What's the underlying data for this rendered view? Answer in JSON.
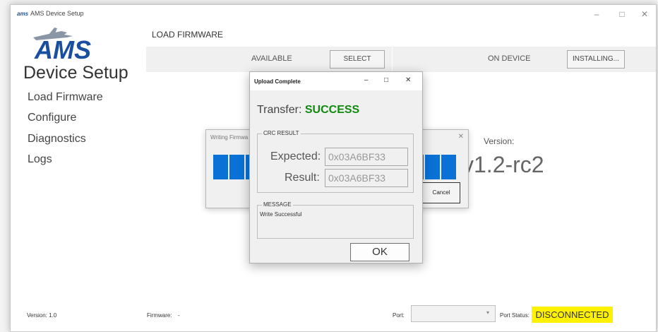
{
  "window": {
    "app_icon_text": "ams",
    "title": "AMS Device Setup",
    "minimize": "–",
    "maximize": "□",
    "close": "✕"
  },
  "brand": {
    "logo_text": "AMS",
    "subtitle": "Device Setup"
  },
  "nav": [
    {
      "label": "Load Firmware"
    },
    {
      "label": "Configure"
    },
    {
      "label": "Diagnostics"
    },
    {
      "label": "Logs"
    }
  ],
  "main": {
    "section_title": "LOAD FIRMWARE",
    "available_label": "AVAILABLE",
    "select_label": "SELECT",
    "on_device_label": "ON DEVICE",
    "installing_label": "INSTALLING...",
    "version_label": "Version:",
    "version_value": "v1.2-rc2"
  },
  "writing_dialog": {
    "title": "Writing Firmwa",
    "close": "✕",
    "cancel_label": "Cancel"
  },
  "upload_dialog": {
    "title": "Upload Complete",
    "minimize": "–",
    "maximize": "□",
    "close": "✕",
    "transfer_label": "Transfer:",
    "transfer_status": "SUCCESS",
    "crc_legend": "CRC RESULT",
    "expected_label": "Expected:",
    "expected_value": "0x03A6BF33",
    "result_label": "Result:",
    "result_value": "0x03A6BF33",
    "message_legend": "MESSAGE",
    "message_text": "Write Successful",
    "ok_label": "OK"
  },
  "statusbar": {
    "version": "Version: 1.0",
    "firmware_label": "Firmware:",
    "firmware_value": "-",
    "port_label": "Port:",
    "port_status_label": "Port Status:",
    "port_status": "DISCONNECTED"
  },
  "colors": {
    "progress": "#0a72d6",
    "success": "#0f8a0f",
    "disconnected_bg": "#fff200",
    "logo": "#1a4fa0"
  }
}
